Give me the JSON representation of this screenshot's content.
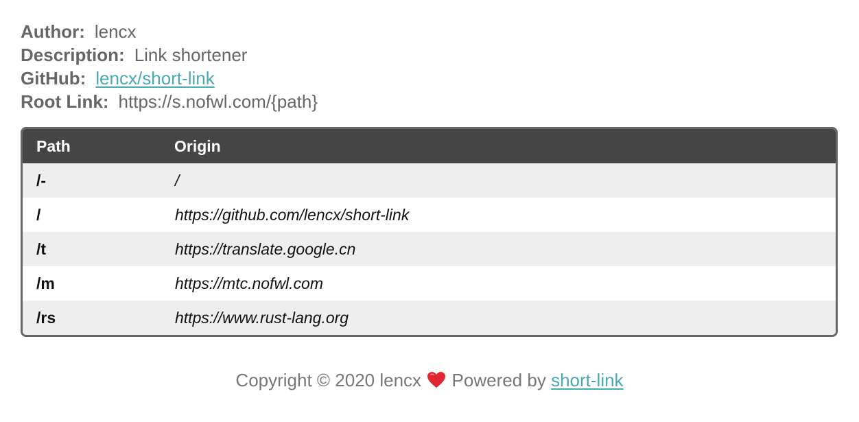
{
  "info": {
    "author_label": "Author:",
    "author_value": "lencx",
    "description_label": "Description:",
    "description_value": "Link shortener",
    "github_label": "GitHub:",
    "github_value": "lencx/short-link",
    "root_label": "Root Link:",
    "root_value": "https://s.nofwl.com/{path}"
  },
  "table": {
    "headers": [
      "Path",
      "Origin"
    ],
    "rows": [
      {
        "path": "/-",
        "origin": "/"
      },
      {
        "path": "/",
        "origin": "https://github.com/lencx/short-link"
      },
      {
        "path": "/t",
        "origin": "https://translate.google.cn"
      },
      {
        "path": "/m",
        "origin": "https://mtc.nofwl.com"
      },
      {
        "path": "/rs",
        "origin": "https://www.rust-lang.org"
      }
    ]
  },
  "footer": {
    "copyright": "Copyright © 2020 lencx",
    "heart_icon": "heart-icon",
    "powered_by": "Powered by",
    "link_text": "short-link"
  },
  "colors": {
    "accent_link": "#4aa9b3",
    "header_bg": "#454545",
    "heart": "#e0262f"
  }
}
